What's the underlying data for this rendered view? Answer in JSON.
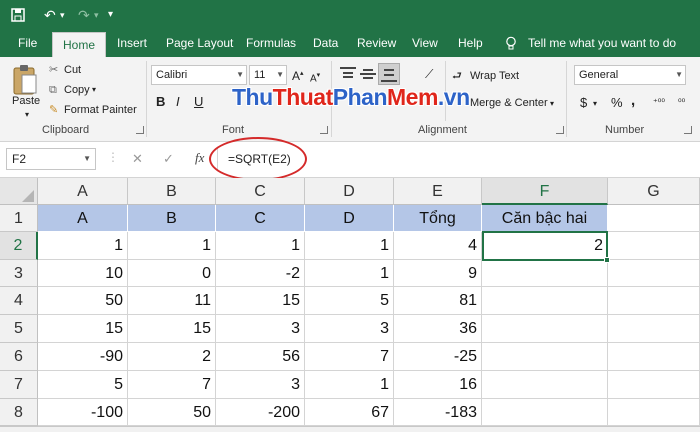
{
  "tabs": {
    "file": "File",
    "home": "Home",
    "insert": "Insert",
    "page_layout": "Page Layout",
    "formulas": "Formulas",
    "data": "Data",
    "review": "Review",
    "view": "View",
    "help": "Help",
    "tell_me": "Tell me what you want to do"
  },
  "clipboard": {
    "paste": "Paste",
    "cut": "Cut",
    "copy": "Copy",
    "format_painter": "Format Painter",
    "label": "Clipboard"
  },
  "font_group": {
    "font_name": "Calibri",
    "font_size": "11",
    "label": "Font"
  },
  "alignment": {
    "wrap_text": "Wrap Text",
    "merge_center": "Merge & Center",
    "label": "Alignment"
  },
  "number": {
    "format": "General",
    "currency": "$",
    "percent": "%",
    "comma": ",",
    "label": "Number"
  },
  "watermark": {
    "part1": "Thu",
    "part2": "Thuat",
    "part3": "Phan",
    "part4": "Mem",
    "part5": ".vn"
  },
  "formula_bar": {
    "name_box": "F2",
    "cancel": "✕",
    "enter": "✓",
    "fx": "fx",
    "formula": "=SQRT(E2)"
  },
  "grid": {
    "columns": [
      "A",
      "B",
      "C",
      "D",
      "E",
      "F",
      "G"
    ],
    "rows": [
      "1",
      "2",
      "3",
      "4",
      "5",
      "6",
      "7",
      "8"
    ],
    "header_row": [
      "A",
      "B",
      "C",
      "D",
      "Tổng",
      "Căn bậc hai"
    ],
    "data_rows": [
      [
        "1",
        "1",
        "1",
        "1",
        "4",
        "2"
      ],
      [
        "10",
        "0",
        "-2",
        "1",
        "9",
        ""
      ],
      [
        "50",
        "11",
        "15",
        "5",
        "81",
        ""
      ],
      [
        "15",
        "15",
        "3",
        "3",
        "36",
        ""
      ],
      [
        "-90",
        "2",
        "56",
        "7",
        "-25",
        ""
      ],
      [
        "5",
        "7",
        "3",
        "1",
        "16",
        ""
      ],
      [
        "-100",
        "50",
        "-200",
        "67",
        "-183",
        ""
      ]
    ],
    "selected_cell": "F2"
  },
  "colors": {
    "excel_green": "#217346",
    "header_fill": "#b4c6e7",
    "annotation_red": "#d42a2a"
  }
}
